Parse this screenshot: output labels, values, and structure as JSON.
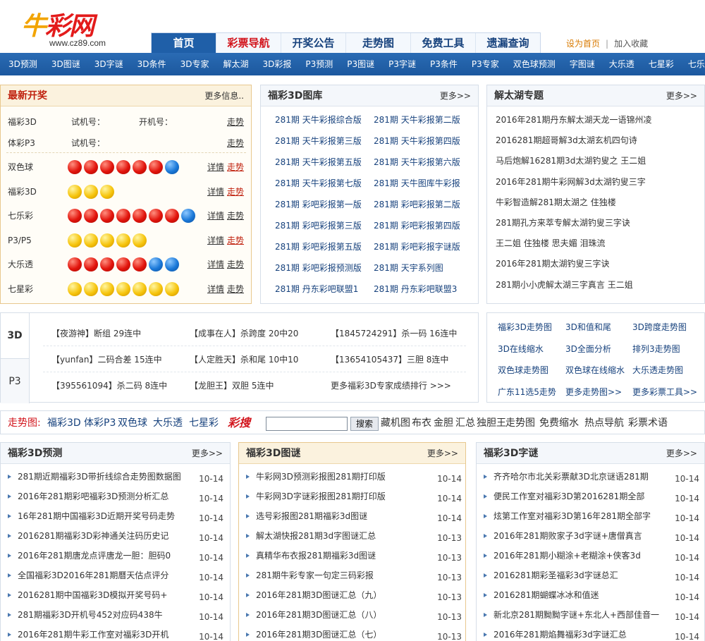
{
  "logo": {
    "main_a": "牛",
    "main_b": "彩网",
    "url": "www.cz89.com"
  },
  "topnav": [
    "首页",
    "彩票导航",
    "开奖公告",
    "走势图",
    "免费工具",
    "遗漏查询"
  ],
  "toplinks": {
    "set_home": "设为首页",
    "sep": "|",
    "fav": "加入收藏"
  },
  "subnav": [
    "3D预测",
    "3D图谜",
    "3D字谜",
    "3D条件",
    "3D专家",
    "解太湖",
    "3D彩报",
    "P3预测",
    "P3图谜",
    "P3字谜",
    "P3条件",
    "P3专家",
    "双色球预测",
    "字图谜",
    "大乐透",
    "七星彩",
    "七乐彩"
  ],
  "latest": {
    "title": "最新开奖",
    "more": "更多信息..",
    "trial": [
      {
        "name": "福彩3D",
        "t1": "试机号：",
        "t2": "开机号：",
        "trend": "走势"
      },
      {
        "name": "体彩P3",
        "t1": "试机号：",
        "t2": "",
        "trend": "走势"
      }
    ],
    "lots": [
      {
        "name": "双色球",
        "balls": [
          "red",
          "red",
          "red",
          "red",
          "red",
          "red",
          "blue"
        ],
        "detail": "详情",
        "trend": "走势",
        "red": true
      },
      {
        "name": "福彩3D",
        "balls": [
          "yellow",
          "yellow",
          "yellow"
        ],
        "detail": "详情",
        "trend": "走势",
        "red": true
      },
      {
        "name": "七乐彩",
        "balls": [
          "red",
          "red",
          "red",
          "red",
          "red",
          "red",
          "red",
          "blue"
        ],
        "detail": "详情",
        "trend": "走势",
        "red": false
      },
      {
        "name": "P3/P5",
        "balls": [
          "yellow",
          "yellow",
          "yellow",
          "yellow",
          "yellow"
        ],
        "detail": "详情",
        "trend": "走势",
        "red": true
      },
      {
        "name": "大乐透",
        "balls": [
          "red",
          "red",
          "red",
          "red",
          "red",
          "blue",
          "blue"
        ],
        "detail": "详情",
        "trend": "走势",
        "red": false
      },
      {
        "name": "七星彩",
        "balls": [
          "yellow",
          "yellow",
          "yellow",
          "yellow",
          "yellow",
          "yellow",
          "yellow"
        ],
        "detail": "详情",
        "trend": "走势",
        "red": false
      }
    ]
  },
  "tuku": {
    "title": "福彩3D图库",
    "more": "更多>>",
    "left": [
      "281期  天牛彩报综合版",
      "281期  天牛彩报第三版",
      "281期  天牛彩报第五版",
      "281期  天牛彩报第七版",
      "281期  彩吧彩报第一版",
      "281期  彩吧彩报第三版",
      "281期  彩吧彩报第五版",
      "281期  彩吧彩报预测版",
      "281期  丹东彩吧联盟1"
    ],
    "right": [
      "281期  天牛彩报第二版",
      "281期  天牛彩报第四版",
      "281期  天牛彩报第六版",
      "281期  天牛图库牛彩报",
      "281期  彩吧彩报第二版",
      "281期  彩吧彩报第四版",
      "281期  彩吧彩报字谜版",
      "281期  天宇系列图",
      "281期  丹东彩吧联盟3"
    ]
  },
  "jtj": {
    "title": "解太湖专题",
    "more": "更多>>",
    "items": [
      "2016年281期丹东解太湖天龙一语锦州凌",
      "2016281期超哥解3d太湖玄机四句诗",
      "马后炮解16281期3d太湖钓叟之 王二姐",
      "2016年281期牛彩网解3d太湖钓叟三字",
      "牛彩智造解281期太湖之 住独楼",
      "281期孔方来萃专解太湖钓叟三字诀",
      "王二姐  住独楼  思夫媚  泪珠流",
      "2016年281期太湖钓叟三字诀",
      "281期小小虎解太湖三字真言  王二姐"
    ]
  },
  "experts": {
    "tab1": "3D",
    "tab2": "P3",
    "rows": [
      [
        "【夜游神】断组  29连中",
        "【成事在人】杀跨度  20中20",
        "【1845724291】杀一码  16连中"
      ],
      [
        "【yunfan】二码合差  15连中",
        "【人定胜天】杀和尾  10中10",
        "【13654105437】三胆  8连中"
      ],
      [
        "【395561094】杀二码  8连中",
        "【龙胆王】双胆  5连中",
        "更多福彩3D专家成绩排行  >>>"
      ]
    ]
  },
  "tools": [
    [
      "福彩3D走势图",
      "3D和值和尾",
      "3D跨度走势图"
    ],
    [
      "3D在线缩水",
      "3D全面分析",
      "排列3走势图"
    ],
    [
      "双色球走势图",
      "双色球在线缩水",
      "大乐透走势图"
    ],
    [
      "广东11选5走势",
      "更多走势图>>",
      "更多彩票工具>>"
    ]
  ],
  "searchbar": {
    "label": "走势图:",
    "links": [
      "福彩3D",
      "体彩P3",
      "双色球",
      "大乐透",
      "七星彩"
    ],
    "caisou": "彩搜",
    "button": "搜索",
    "tags": [
      "藏机图",
      "布衣",
      "金胆",
      "汇总",
      "独胆王",
      "走势图",
      "免费缩水",
      "热点导航",
      "彩票术语"
    ]
  },
  "news1": {
    "title": "福彩3D预测",
    "more": "更多>>",
    "rows": [
      [
        "281期近期福彩3D带折线综合走势图数据图",
        "10-14"
      ],
      [
        "2016年281期彩吧福彩3D预测分析汇总",
        "10-14"
      ],
      [
        "16年281期中国福彩3D近期开奖号码走势",
        "10-14"
      ],
      [
        "2016281期福彩3D彩神通关注码历史记",
        "10-14"
      ],
      [
        "2016年281期唐龙点评唐龙一胆：胆码0",
        "10-14"
      ],
      [
        "全国福彩3D2016年281期曆天估点评分",
        "10-14"
      ],
      [
        "2016281期中国福彩3D模拟开奖号码+",
        "10-14"
      ],
      [
        "281期福彩3D开机号452对应码438牛",
        "10-14"
      ],
      [
        "2016年281期牛彩工作室对福彩3D开机",
        "10-14"
      ]
    ]
  },
  "news2": {
    "title": "福彩3D图谜",
    "more": "更多>>",
    "rows": [
      [
        "牛彩网3D预测彩报图281期打印版",
        "10-14"
      ],
      [
        "牛彩网3D字谜彩报图281期打印版",
        "10-14"
      ],
      [
        "选号彩报图281期福彩3d图谜",
        "10-14"
      ],
      [
        "解太湖快报281期3d字图谜汇总",
        "10-13"
      ],
      [
        "真精华布衣报281期福彩3d图谜",
        "10-13"
      ],
      [
        "281期牛彩专家一句定三码彩报",
        "10-13"
      ],
      [
        "2016年281期3D图谜汇总（九）",
        "10-13"
      ],
      [
        "2016年281期3D图谜汇总（八）",
        "10-13"
      ],
      [
        "2016年281期3D图谜汇总（七）",
        "10-13"
      ]
    ]
  },
  "news3": {
    "title": "福彩3D字谜",
    "more": "更多>>",
    "rows": [
      [
        "齐齐哈尔市北关彩票献3D北京谜语281期",
        "10-14"
      ],
      [
        "便民工作室对福彩3D第2016281期全部",
        "10-14"
      ],
      [
        "炫第工作室对福彩3D第16年281期全部字",
        "10-14"
      ],
      [
        "2016年281期败家子3d字谜+唐僧真言",
        "10-14"
      ],
      [
        "2016年281期小糊涂+老糊涂+侠客3d",
        "10-14"
      ],
      [
        "2016281期彩圣福彩3d字谜总汇",
        "10-14"
      ],
      [
        "2016281期蝴蝶冰冰和值迷",
        "10-14"
      ],
      [
        "新北京281期黝黝字谜+东北人+西部佳音一",
        "10-14"
      ],
      [
        "2016年281期焰舞福彩3d字谜汇总",
        "10-14"
      ]
    ]
  }
}
